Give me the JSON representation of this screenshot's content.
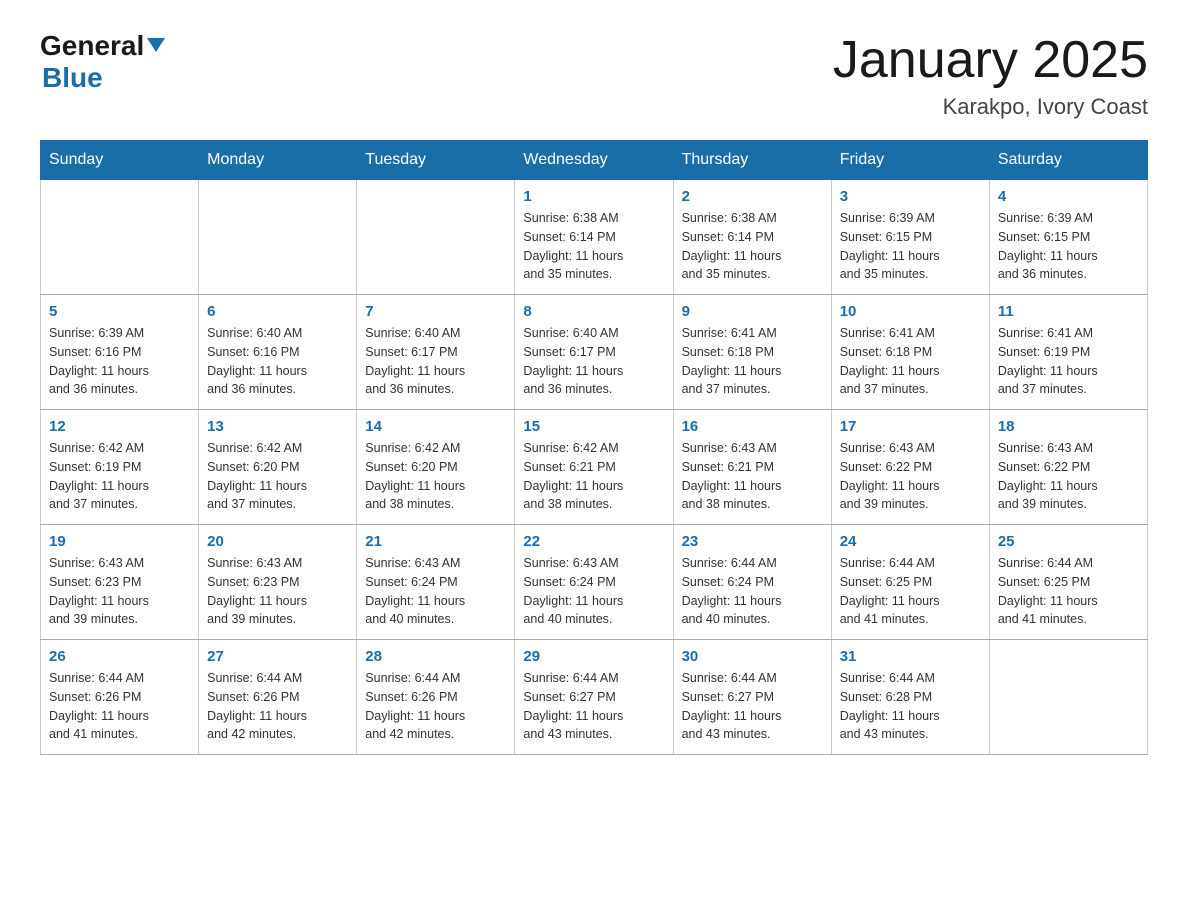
{
  "header": {
    "logo_general": "General",
    "logo_blue": "Blue",
    "title": "January 2025",
    "subtitle": "Karakpo, Ivory Coast"
  },
  "weekdays": [
    "Sunday",
    "Monday",
    "Tuesday",
    "Wednesday",
    "Thursday",
    "Friday",
    "Saturday"
  ],
  "weeks": [
    [
      {
        "day": "",
        "info": ""
      },
      {
        "day": "",
        "info": ""
      },
      {
        "day": "",
        "info": ""
      },
      {
        "day": "1",
        "info": "Sunrise: 6:38 AM\nSunset: 6:14 PM\nDaylight: 11 hours\nand 35 minutes."
      },
      {
        "day": "2",
        "info": "Sunrise: 6:38 AM\nSunset: 6:14 PM\nDaylight: 11 hours\nand 35 minutes."
      },
      {
        "day": "3",
        "info": "Sunrise: 6:39 AM\nSunset: 6:15 PM\nDaylight: 11 hours\nand 35 minutes."
      },
      {
        "day": "4",
        "info": "Sunrise: 6:39 AM\nSunset: 6:15 PM\nDaylight: 11 hours\nand 36 minutes."
      }
    ],
    [
      {
        "day": "5",
        "info": "Sunrise: 6:39 AM\nSunset: 6:16 PM\nDaylight: 11 hours\nand 36 minutes."
      },
      {
        "day": "6",
        "info": "Sunrise: 6:40 AM\nSunset: 6:16 PM\nDaylight: 11 hours\nand 36 minutes."
      },
      {
        "day": "7",
        "info": "Sunrise: 6:40 AM\nSunset: 6:17 PM\nDaylight: 11 hours\nand 36 minutes."
      },
      {
        "day": "8",
        "info": "Sunrise: 6:40 AM\nSunset: 6:17 PM\nDaylight: 11 hours\nand 36 minutes."
      },
      {
        "day": "9",
        "info": "Sunrise: 6:41 AM\nSunset: 6:18 PM\nDaylight: 11 hours\nand 37 minutes."
      },
      {
        "day": "10",
        "info": "Sunrise: 6:41 AM\nSunset: 6:18 PM\nDaylight: 11 hours\nand 37 minutes."
      },
      {
        "day": "11",
        "info": "Sunrise: 6:41 AM\nSunset: 6:19 PM\nDaylight: 11 hours\nand 37 minutes."
      }
    ],
    [
      {
        "day": "12",
        "info": "Sunrise: 6:42 AM\nSunset: 6:19 PM\nDaylight: 11 hours\nand 37 minutes."
      },
      {
        "day": "13",
        "info": "Sunrise: 6:42 AM\nSunset: 6:20 PM\nDaylight: 11 hours\nand 37 minutes."
      },
      {
        "day": "14",
        "info": "Sunrise: 6:42 AM\nSunset: 6:20 PM\nDaylight: 11 hours\nand 38 minutes."
      },
      {
        "day": "15",
        "info": "Sunrise: 6:42 AM\nSunset: 6:21 PM\nDaylight: 11 hours\nand 38 minutes."
      },
      {
        "day": "16",
        "info": "Sunrise: 6:43 AM\nSunset: 6:21 PM\nDaylight: 11 hours\nand 38 minutes."
      },
      {
        "day": "17",
        "info": "Sunrise: 6:43 AM\nSunset: 6:22 PM\nDaylight: 11 hours\nand 39 minutes."
      },
      {
        "day": "18",
        "info": "Sunrise: 6:43 AM\nSunset: 6:22 PM\nDaylight: 11 hours\nand 39 minutes."
      }
    ],
    [
      {
        "day": "19",
        "info": "Sunrise: 6:43 AM\nSunset: 6:23 PM\nDaylight: 11 hours\nand 39 minutes."
      },
      {
        "day": "20",
        "info": "Sunrise: 6:43 AM\nSunset: 6:23 PM\nDaylight: 11 hours\nand 39 minutes."
      },
      {
        "day": "21",
        "info": "Sunrise: 6:43 AM\nSunset: 6:24 PM\nDaylight: 11 hours\nand 40 minutes."
      },
      {
        "day": "22",
        "info": "Sunrise: 6:43 AM\nSunset: 6:24 PM\nDaylight: 11 hours\nand 40 minutes."
      },
      {
        "day": "23",
        "info": "Sunrise: 6:44 AM\nSunset: 6:24 PM\nDaylight: 11 hours\nand 40 minutes."
      },
      {
        "day": "24",
        "info": "Sunrise: 6:44 AM\nSunset: 6:25 PM\nDaylight: 11 hours\nand 41 minutes."
      },
      {
        "day": "25",
        "info": "Sunrise: 6:44 AM\nSunset: 6:25 PM\nDaylight: 11 hours\nand 41 minutes."
      }
    ],
    [
      {
        "day": "26",
        "info": "Sunrise: 6:44 AM\nSunset: 6:26 PM\nDaylight: 11 hours\nand 41 minutes."
      },
      {
        "day": "27",
        "info": "Sunrise: 6:44 AM\nSunset: 6:26 PM\nDaylight: 11 hours\nand 42 minutes."
      },
      {
        "day": "28",
        "info": "Sunrise: 6:44 AM\nSunset: 6:26 PM\nDaylight: 11 hours\nand 42 minutes."
      },
      {
        "day": "29",
        "info": "Sunrise: 6:44 AM\nSunset: 6:27 PM\nDaylight: 11 hours\nand 43 minutes."
      },
      {
        "day": "30",
        "info": "Sunrise: 6:44 AM\nSunset: 6:27 PM\nDaylight: 11 hours\nand 43 minutes."
      },
      {
        "day": "31",
        "info": "Sunrise: 6:44 AM\nSunset: 6:28 PM\nDaylight: 11 hours\nand 43 minutes."
      },
      {
        "day": "",
        "info": ""
      }
    ]
  ]
}
